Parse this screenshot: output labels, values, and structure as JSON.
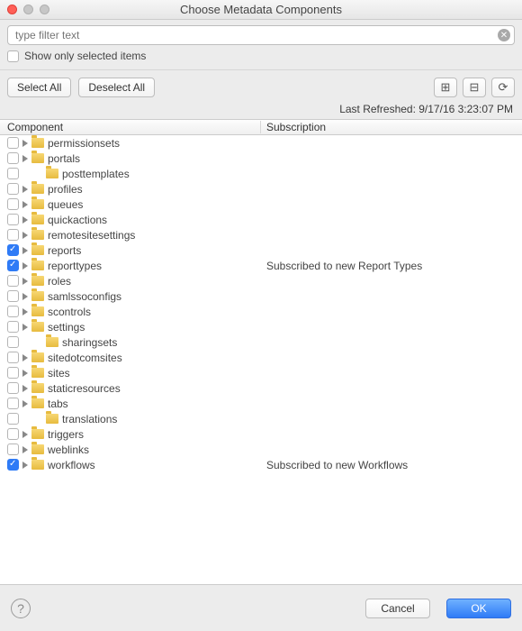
{
  "window": {
    "title": "Choose Metadata Components"
  },
  "filter": {
    "placeholder": "type filter text",
    "show_only_selected_label": "Show only selected items"
  },
  "toolbar": {
    "select_all": "Select All",
    "deselect_all": "Deselect All",
    "icons": {
      "expand_all": "expand-all-icon",
      "collapse_all": "collapse-all-icon",
      "refresh": "refresh-icon"
    }
  },
  "status": {
    "last_refreshed": "Last Refreshed: 9/17/16 3:23:07 PM"
  },
  "columns": {
    "component": "Component",
    "subscription": "Subscription"
  },
  "tree": [
    {
      "label": "permissionsets",
      "checked": false,
      "expandable": true,
      "indent": 0,
      "subscription": ""
    },
    {
      "label": "portals",
      "checked": false,
      "expandable": true,
      "indent": 0,
      "subscription": ""
    },
    {
      "label": "posttemplates",
      "checked": false,
      "expandable": false,
      "indent": 1,
      "subscription": ""
    },
    {
      "label": "profiles",
      "checked": false,
      "expandable": true,
      "indent": 0,
      "subscription": ""
    },
    {
      "label": "queues",
      "checked": false,
      "expandable": true,
      "indent": 0,
      "subscription": ""
    },
    {
      "label": "quickactions",
      "checked": false,
      "expandable": true,
      "indent": 0,
      "subscription": ""
    },
    {
      "label": "remotesitesettings",
      "checked": false,
      "expandable": true,
      "indent": 0,
      "subscription": ""
    },
    {
      "label": "reports",
      "checked": true,
      "expandable": true,
      "indent": 0,
      "subscription": ""
    },
    {
      "label": "reporttypes",
      "checked": true,
      "expandable": true,
      "indent": 0,
      "subscription": "Subscribed to new Report Types"
    },
    {
      "label": "roles",
      "checked": false,
      "expandable": true,
      "indent": 0,
      "subscription": ""
    },
    {
      "label": "samlssoconfigs",
      "checked": false,
      "expandable": true,
      "indent": 0,
      "subscription": ""
    },
    {
      "label": "scontrols",
      "checked": false,
      "expandable": true,
      "indent": 0,
      "subscription": ""
    },
    {
      "label": "settings",
      "checked": false,
      "expandable": true,
      "indent": 0,
      "subscription": ""
    },
    {
      "label": "sharingsets",
      "checked": false,
      "expandable": false,
      "indent": 1,
      "subscription": ""
    },
    {
      "label": "sitedotcomsites",
      "checked": false,
      "expandable": true,
      "indent": 0,
      "subscription": ""
    },
    {
      "label": "sites",
      "checked": false,
      "expandable": true,
      "indent": 0,
      "subscription": ""
    },
    {
      "label": "staticresources",
      "checked": false,
      "expandable": true,
      "indent": 0,
      "subscription": ""
    },
    {
      "label": "tabs",
      "checked": false,
      "expandable": true,
      "indent": 0,
      "subscription": ""
    },
    {
      "label": "translations",
      "checked": false,
      "expandable": false,
      "indent": 1,
      "subscription": ""
    },
    {
      "label": "triggers",
      "checked": false,
      "expandable": true,
      "indent": 0,
      "subscription": ""
    },
    {
      "label": "weblinks",
      "checked": false,
      "expandable": true,
      "indent": 0,
      "subscription": ""
    },
    {
      "label": "workflows",
      "checked": true,
      "expandable": true,
      "indent": 0,
      "subscription": "Subscribed to new Workflows"
    }
  ],
  "footer": {
    "cancel": "Cancel",
    "ok": "OK"
  }
}
